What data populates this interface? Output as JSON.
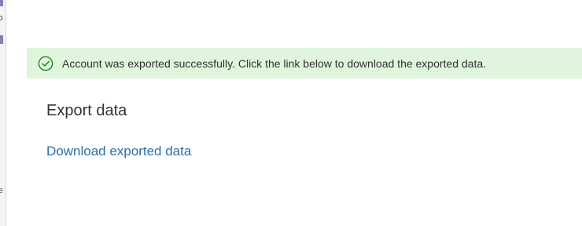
{
  "banner": {
    "status_icon": "check-circle-icon",
    "message": "Account was exported successfully. Click the link below to download the exported data."
  },
  "export": {
    "heading": "Export data",
    "download_link": "Download exported data"
  },
  "colors": {
    "banner_background": "#dff6dd",
    "success_green": "#107c10",
    "link_blue": "#2b6cb0",
    "text": "#323130"
  }
}
